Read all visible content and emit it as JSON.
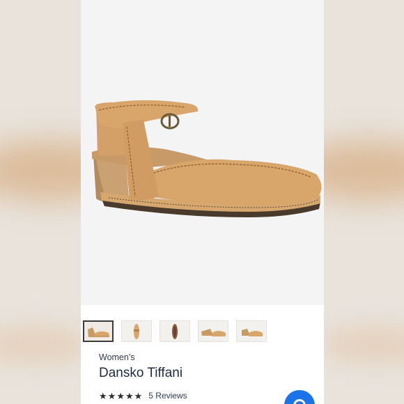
{
  "product": {
    "category": "Women’s",
    "title": "Dansko Tiffani",
    "rating_stars": 5,
    "reviews": "5 Reviews"
  },
  "thumbnails": [
    {
      "name": "side-view",
      "active": true
    },
    {
      "name": "sole-top-view",
      "active": false
    },
    {
      "name": "outsole-view",
      "active": false
    },
    {
      "name": "pair-view",
      "active": false
    },
    {
      "name": "angle-view",
      "active": false
    }
  ],
  "colors": {
    "leather": "#d8a56b",
    "stitch": "#8a5a2b",
    "accent": "#1a73e8"
  },
  "icons": {
    "fab": "assistant-icon"
  }
}
